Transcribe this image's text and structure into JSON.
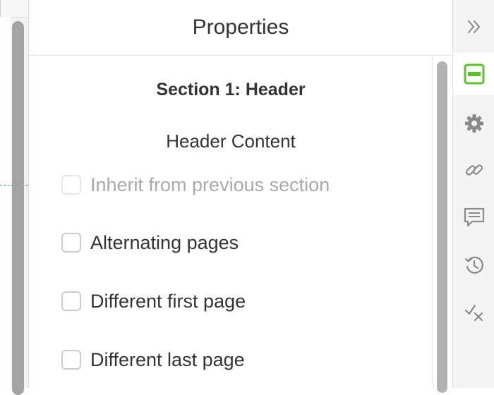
{
  "panel": {
    "title": "Properties",
    "section_title": "Section 1: Header",
    "subsection_title": "Header Content",
    "options": [
      {
        "label": "Inherit from previous section",
        "checked": false,
        "disabled": true
      },
      {
        "label": "Alternating pages",
        "checked": false,
        "disabled": false
      },
      {
        "label": "Different first page",
        "checked": false,
        "disabled": false
      },
      {
        "label": "Different last page",
        "checked": false,
        "disabled": false
      }
    ]
  },
  "rail": {
    "buttons": [
      {
        "icon": "double-chevron-right-icon",
        "active": false
      },
      {
        "icon": "header-footer-icon",
        "active": true
      },
      {
        "icon": "gear-icon",
        "active": false
      },
      {
        "icon": "link-icon",
        "active": false
      },
      {
        "icon": "comment-icon",
        "active": false
      },
      {
        "icon": "history-icon",
        "active": false
      },
      {
        "icon": "check-x-icon",
        "active": false
      }
    ]
  },
  "colors": {
    "accent": "#5cc12f",
    "icon": "#8a8a8a",
    "guide": "#3b7fd1",
    "text": "#333333",
    "disabled_text": "#aaaaaa"
  }
}
